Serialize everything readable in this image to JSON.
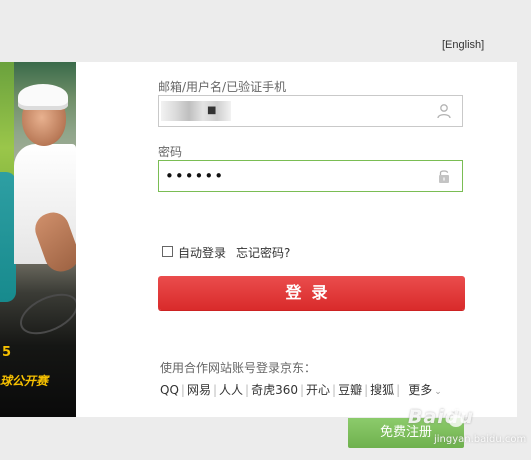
{
  "header": {
    "language_link": "[English]"
  },
  "banner": {
    "promo_line1": "5",
    "promo_line2": "球公开赛"
  },
  "login_form": {
    "username": {
      "label": "邮箱/用户名/已验证手机",
      "value": "■",
      "icon": "user-icon"
    },
    "password": {
      "label": "密码",
      "masked_value": "••••••",
      "icon": "lock-icon",
      "focused_border_color": "#7abd54"
    },
    "auto_login": {
      "label": "自动登录",
      "checked": false
    },
    "forgot_password": "忘记密码?",
    "submit": {
      "label": "登录",
      "color": "#e23b3b"
    }
  },
  "partners": {
    "title": "使用合作网站账号登录京东：",
    "items": [
      "QQ",
      "网易",
      "人人",
      "奇虎360",
      "开心",
      "豆瓣",
      "搜狐"
    ],
    "more_label": "更多",
    "more_icon": "chevron-down-icon"
  },
  "register": {
    "label": "免费注册",
    "color": "#7abd54"
  },
  "watermark": {
    "brand": "Baidu",
    "site": "jingyan.baidu.com"
  }
}
